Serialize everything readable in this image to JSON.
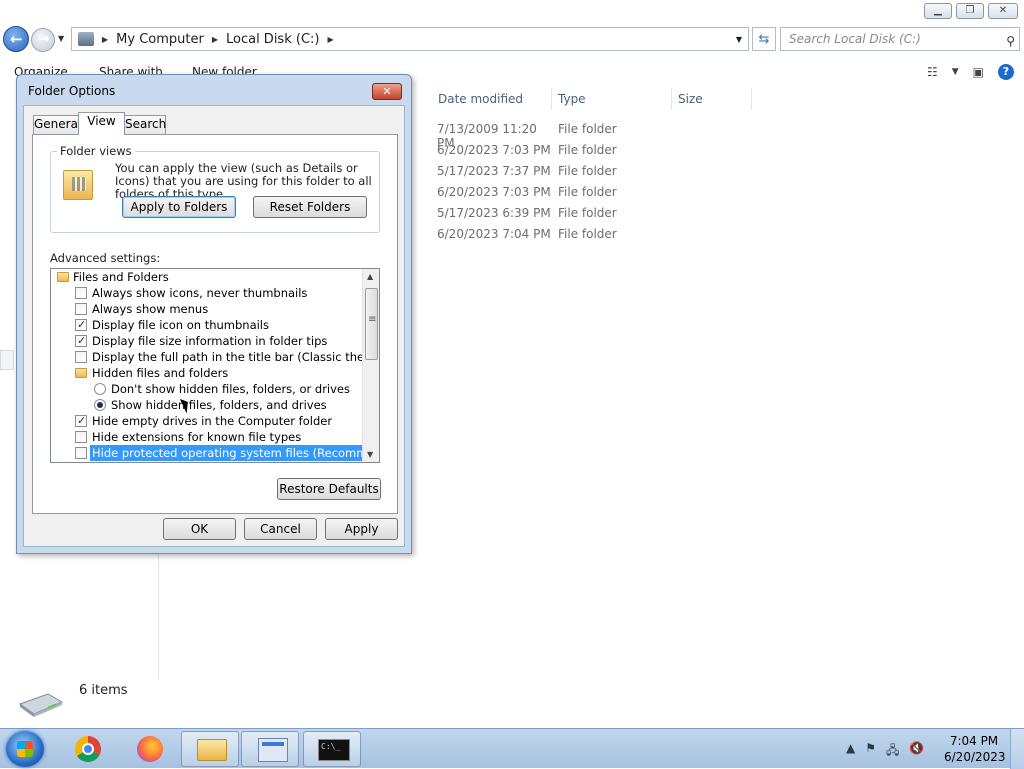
{
  "explorer": {
    "breadcrumb": [
      "My Computer",
      "Local Disk (C:)"
    ],
    "search_placeholder": "Search Local Disk (C:)",
    "commands": [
      "Organize",
      "Share with",
      "New folder"
    ],
    "columns": [
      "Date modified",
      "Type",
      "Size"
    ],
    "rows": [
      {
        "date": "7/13/2009 11:20 PM",
        "type": "File folder"
      },
      {
        "date": "6/20/2023 7:03 PM",
        "type": "File folder"
      },
      {
        "date": "5/17/2023 7:37 PM",
        "type": "File folder"
      },
      {
        "date": "6/20/2023 7:03 PM",
        "type": "File folder"
      },
      {
        "date": "5/17/2023 6:39 PM",
        "type": "File folder"
      },
      {
        "date": "6/20/2023 7:04 PM",
        "type": "File folder"
      }
    ],
    "status_count": "6 items"
  },
  "dialog": {
    "title": "Folder Options",
    "tabs": [
      "General",
      "View",
      "Search"
    ],
    "active_tab": "View",
    "folder_views": {
      "label": "Folder views",
      "text": "You can apply the view (such as Details or Icons) that you are using for this folder to all folders of this type.",
      "apply_label": "Apply to Folders",
      "reset_label": "Reset Folders"
    },
    "advanced_label": "Advanced settings:",
    "tree": [
      {
        "kind": "folder",
        "label": "Files and Folders"
      },
      {
        "kind": "check",
        "label": "Always show icons, never thumbnails",
        "checked": false
      },
      {
        "kind": "check",
        "label": "Always show menus",
        "checked": false
      },
      {
        "kind": "check",
        "label": "Display file icon on thumbnails",
        "checked": true
      },
      {
        "kind": "check",
        "label": "Display file size information in folder tips",
        "checked": true
      },
      {
        "kind": "check",
        "label": "Display the full path in the title bar (Classic theme only)",
        "checked": false
      },
      {
        "kind": "folder",
        "label": "Hidden files and folders"
      },
      {
        "kind": "radio",
        "label": "Don't show hidden files, folders, or drives",
        "checked": false
      },
      {
        "kind": "radio",
        "label": "Show hidden files, folders, and drives",
        "checked": true
      },
      {
        "kind": "check",
        "label": "Hide empty drives in the Computer folder",
        "checked": true
      },
      {
        "kind": "check",
        "label": "Hide extensions for known file types",
        "checked": false
      },
      {
        "kind": "check",
        "label": "Hide protected operating system files (Recommended)",
        "checked": false,
        "selected": true
      }
    ],
    "restore_label": "Restore Defaults",
    "ok_label": "OK",
    "cancel_label": "Cancel",
    "apply_label": "Apply"
  },
  "taskbar": {
    "time": "7:04 PM",
    "date": "6/20/2023"
  }
}
